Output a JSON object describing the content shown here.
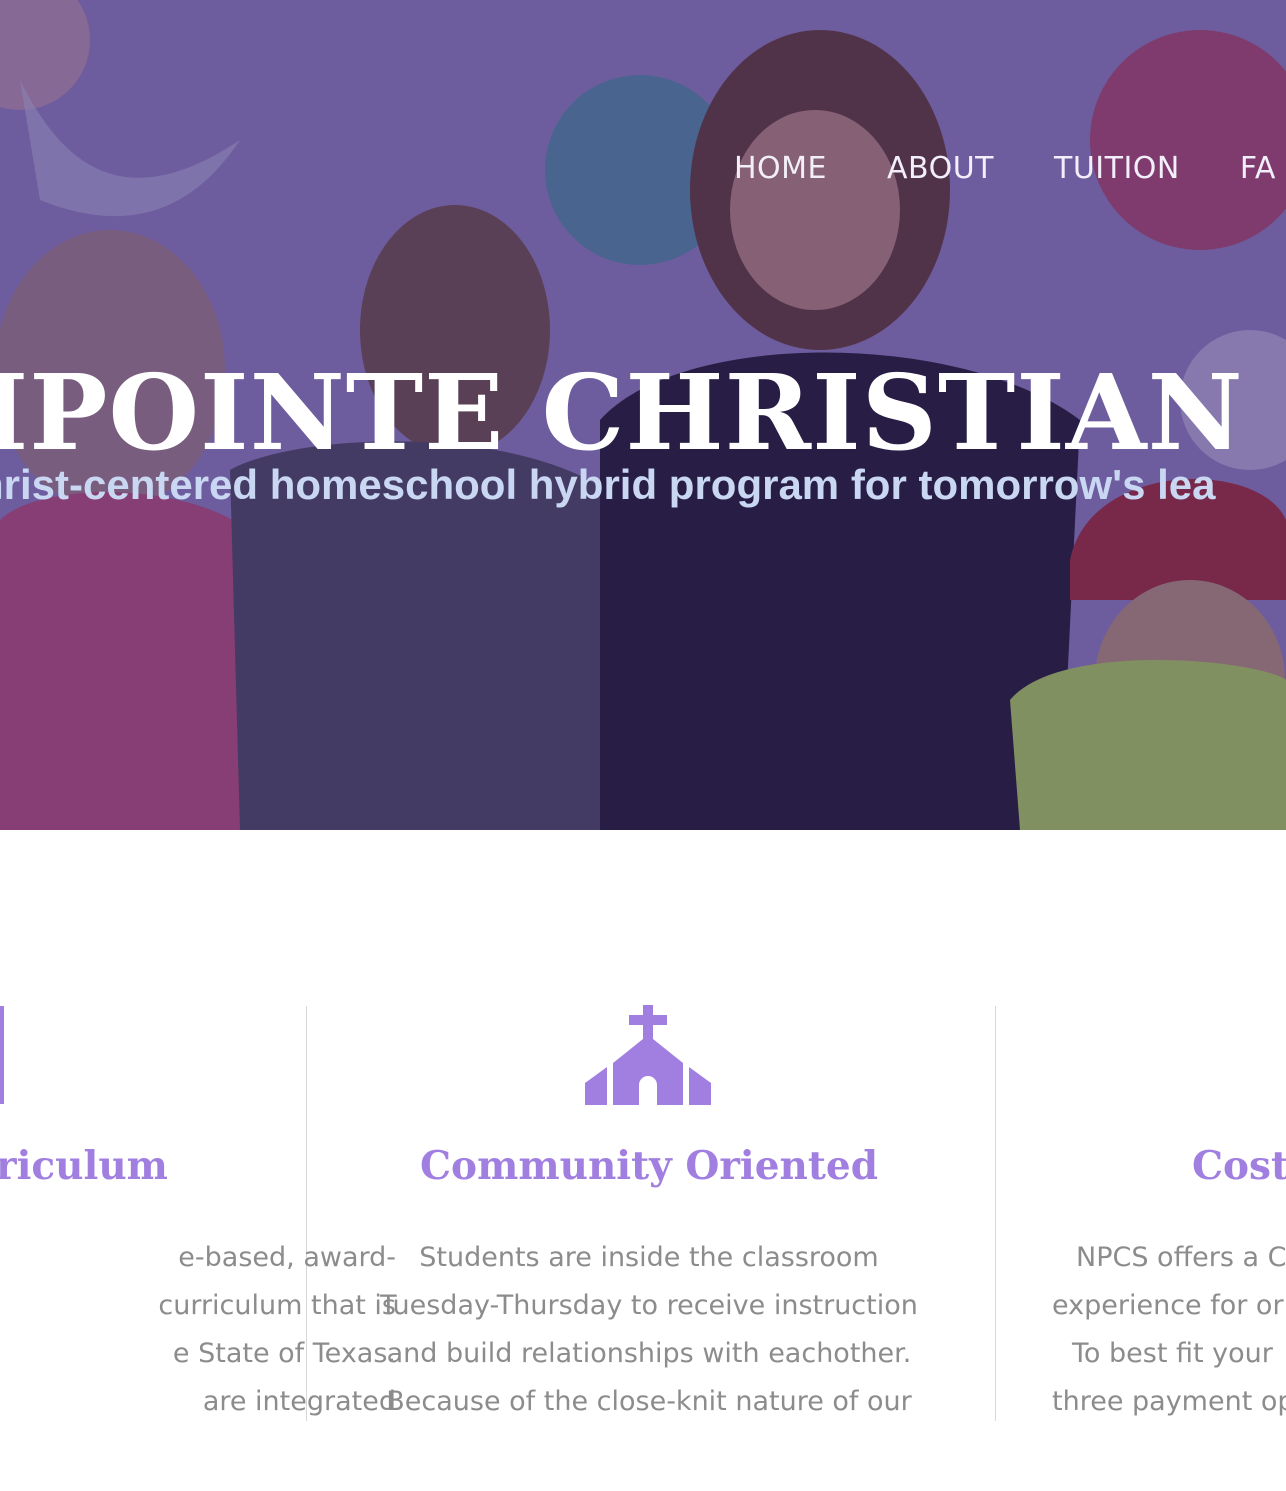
{
  "nav": {
    "items": [
      "HOME",
      "ABOUT",
      "TUITION",
      "FA"
    ]
  },
  "hero": {
    "title": "HPOINTE CHRISTIAN S",
    "subtitle": "hrist-centered homeschool hybrid program for tomorrow's lea"
  },
  "features": [
    {
      "icon": "book-icon",
      "title": "riculum",
      "lines": [
        "e-based, award-",
        "curriculum that is",
        "e State of Texas.",
        "are integrated"
      ]
    },
    {
      "icon": "church-icon",
      "title": "Community Oriented",
      "lines": [
        "Students are inside the classroom",
        "Tuesday-Thursday to receive instruction",
        "and build relationships with eachother.",
        "Because of the close-knit nature of our"
      ]
    },
    {
      "icon": "cost-icon",
      "title": "Cost",
      "lines": [
        "NPCS offers a C",
        "experience for or",
        "To best fit your",
        "three payment op"
      ]
    }
  ],
  "colors": {
    "accent": "#a17fe0",
    "body_text": "#8c8c8c",
    "hero_overlay": "#3a286e"
  }
}
